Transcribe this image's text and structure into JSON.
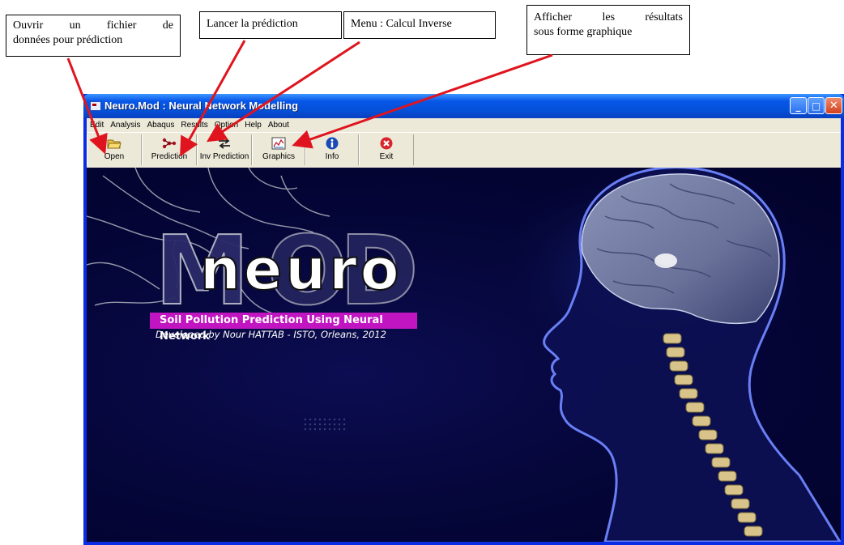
{
  "annotations": {
    "open_file": {
      "line1": [
        "Ouvrir",
        "un",
        "fichier",
        "de"
      ],
      "line2": "données pour prédiction"
    },
    "launch_prediction": "Lancer la prédiction",
    "inverse_menu": "Menu : Calcul Inverse",
    "graphics": {
      "line1": [
        "Afficher",
        "les",
        "résultats"
      ],
      "line2": "sous forme graphique"
    }
  },
  "window": {
    "title": "Neuro.Mod : Neural Network Modelling",
    "controls": {
      "minimize": "_",
      "maximize": "□",
      "close": "✕"
    }
  },
  "menu": [
    "Edit",
    "Analysis",
    "Abaqus",
    "Results",
    "Option",
    "Help",
    "About"
  ],
  "toolbar": [
    {
      "label": "Open",
      "icon": "open-folder-icon"
    },
    {
      "label": "Prediction",
      "icon": "network-icon"
    },
    {
      "label": "Inv Prediction",
      "icon": "inverse-arrows-icon"
    },
    {
      "label": "Graphics",
      "icon": "chart-icon"
    },
    {
      "label": "Info",
      "icon": "info-icon"
    },
    {
      "label": "Exit",
      "icon": "exit-icon"
    }
  ],
  "splash": {
    "logo_word": "neuro",
    "logo_letters": [
      "M",
      "O",
      "D"
    ],
    "tagline": "Soil Pollution Prediction Using Neural Network",
    "credits": "Developed by Nour HATTAB - ISTO, Orleans, 2012"
  },
  "colors": {
    "window_frame": "#0a2ce3",
    "title_bar": "#0450d6",
    "toolbar_bg": "#ece9d8",
    "splash_bg": "#05063a",
    "banner": "#c015c0",
    "arrow": "#e0141e"
  }
}
